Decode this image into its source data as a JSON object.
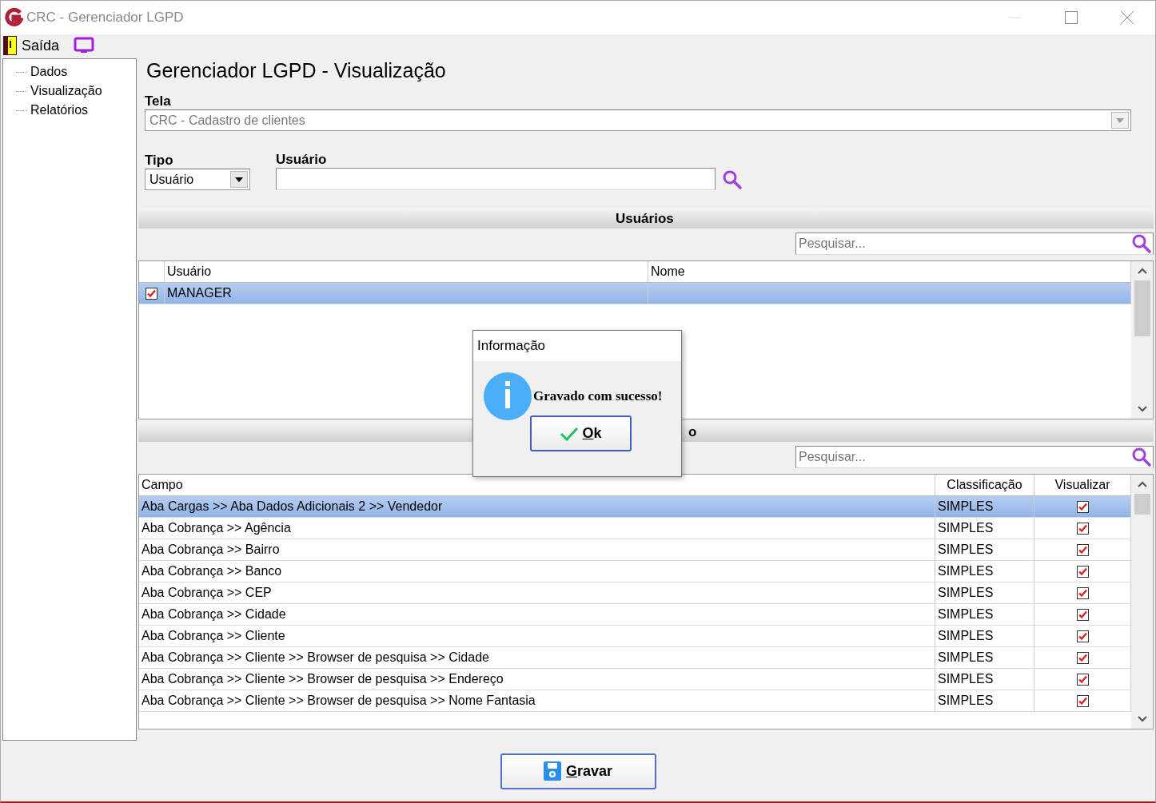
{
  "window": {
    "title": "CRC - Gerenciador LGPD"
  },
  "menu": [
    {
      "kind": "exit",
      "label": "Saída"
    },
    {
      "kind": "screen"
    }
  ],
  "sidebar": {
    "items": [
      {
        "label": "Dados",
        "selected": false
      },
      {
        "label": "Visualização",
        "selected": false
      },
      {
        "label": "Relatórios",
        "selected": false
      }
    ]
  },
  "heading": "Gerenciador LGPD - Visualização",
  "tela": {
    "label": "Tela",
    "value": "CRC - Cadastro de clientes"
  },
  "tipo": {
    "label": "Tipo",
    "value": "Usuário"
  },
  "usuario": {
    "label": "Usuário"
  },
  "users_section": {
    "title": "Usuários",
    "search": {
      "placeholder": "Pesquisar..."
    },
    "columns": [
      "Usuário",
      "Nome"
    ],
    "rows": [
      {
        "usuario": "MANAGER",
        "nome": "",
        "checked": true,
        "selected": true
      }
    ]
  },
  "fields_section": {
    "title": "o",
    "search": {
      "placeholder": "Pesquisar..."
    },
    "columns": [
      "Campo",
      "Classificação",
      "Visualizar"
    ],
    "rows": [
      {
        "campo": "Aba Cargas >> Aba Dados Adicionais 2 >> Vendedor",
        "classificacao": "SIMPLES",
        "checked": true,
        "selected": true
      },
      {
        "campo": "Aba Cobrança >> Agência",
        "classificacao": "SIMPLES",
        "checked": true,
        "selected": false
      },
      {
        "campo": "Aba Cobrança >> Bairro",
        "classificacao": "SIMPLES",
        "checked": true,
        "selected": false
      },
      {
        "campo": "Aba Cobrança >> Banco",
        "classificacao": "SIMPLES",
        "checked": true,
        "selected": false
      },
      {
        "campo": "Aba Cobrança >> CEP",
        "classificacao": "SIMPLES",
        "checked": true,
        "selected": false
      },
      {
        "campo": "Aba Cobrança >> Cidade",
        "classificacao": "SIMPLES",
        "checked": true,
        "selected": false
      },
      {
        "campo": "Aba Cobrança >> Cliente",
        "classificacao": "SIMPLES",
        "checked": true,
        "selected": false
      },
      {
        "campo": "Aba Cobrança >> Cliente >> Browser de pesquisa >> Cidade",
        "classificacao": "SIMPLES",
        "checked": true,
        "selected": false
      },
      {
        "campo": "Aba Cobrança >> Cliente >> Browser de pesquisa >> Endereço",
        "classificacao": "SIMPLES",
        "checked": true,
        "selected": false
      },
      {
        "campo": "Aba Cobrança >> Cliente >> Browser de pesquisa >> Nome Fantasia",
        "classificacao": "SIMPLES",
        "checked": true,
        "selected": false
      }
    ]
  },
  "save_button": {
    "label": "Gravar",
    "underline_first": true
  },
  "dialog": {
    "title": "Informação",
    "message": "Gravado com sucesso!",
    "button": {
      "label": "Ok",
      "underline_first": true
    }
  }
}
